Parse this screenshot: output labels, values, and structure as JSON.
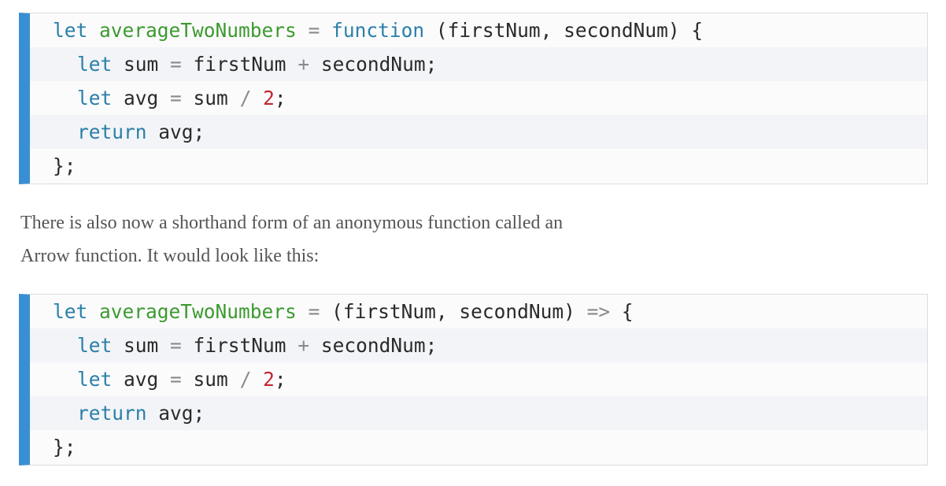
{
  "code_block_1": {
    "lines": [
      {
        "indent": 0,
        "tokens": [
          {
            "t": "let",
            "c": "kw"
          },
          {
            "t": " ",
            "c": "id"
          },
          {
            "t": "averageTwoNumbers",
            "c": "fn"
          },
          {
            "t": " ",
            "c": "id"
          },
          {
            "t": "=",
            "c": "op"
          },
          {
            "t": " ",
            "c": "id"
          },
          {
            "t": "function",
            "c": "kw"
          },
          {
            "t": " (firstNum, secondNum) {",
            "c": "id"
          }
        ]
      },
      {
        "indent": 1,
        "tokens": [
          {
            "t": "let",
            "c": "kw"
          },
          {
            "t": " sum ",
            "c": "id"
          },
          {
            "t": "=",
            "c": "op"
          },
          {
            "t": " firstNum ",
            "c": "id"
          },
          {
            "t": "+",
            "c": "op"
          },
          {
            "t": " secondNum;",
            "c": "id"
          }
        ]
      },
      {
        "indent": 1,
        "tokens": [
          {
            "t": "let",
            "c": "kw"
          },
          {
            "t": " avg ",
            "c": "id"
          },
          {
            "t": "=",
            "c": "op"
          },
          {
            "t": " sum ",
            "c": "id"
          },
          {
            "t": "/",
            "c": "op"
          },
          {
            "t": " ",
            "c": "id"
          },
          {
            "t": "2",
            "c": "num"
          },
          {
            "t": ";",
            "c": "id"
          }
        ]
      },
      {
        "indent": 1,
        "tokens": [
          {
            "t": "return",
            "c": "kw"
          },
          {
            "t": " avg;",
            "c": "id"
          }
        ]
      },
      {
        "indent": 0,
        "tokens": [
          {
            "t": "};",
            "c": "id"
          }
        ]
      }
    ]
  },
  "prose": {
    "line_1": "There is also now a shorthand form of an anonymous function called an",
    "line_2": "Arrow function. It would look like this:"
  },
  "code_block_2": {
    "lines": [
      {
        "indent": 0,
        "tokens": [
          {
            "t": "let",
            "c": "kw"
          },
          {
            "t": " ",
            "c": "id"
          },
          {
            "t": "averageTwoNumbers",
            "c": "fn"
          },
          {
            "t": " ",
            "c": "id"
          },
          {
            "t": "=",
            "c": "op"
          },
          {
            "t": " (firstNum, secondNum) ",
            "c": "id"
          },
          {
            "t": "=>",
            "c": "op"
          },
          {
            "t": " {",
            "c": "id"
          }
        ]
      },
      {
        "indent": 1,
        "tokens": [
          {
            "t": "let",
            "c": "kw"
          },
          {
            "t": " sum ",
            "c": "id"
          },
          {
            "t": "=",
            "c": "op"
          },
          {
            "t": " firstNum ",
            "c": "id"
          },
          {
            "t": "+",
            "c": "op"
          },
          {
            "t": " secondNum;",
            "c": "id"
          }
        ]
      },
      {
        "indent": 1,
        "tokens": [
          {
            "t": "let",
            "c": "kw"
          },
          {
            "t": " avg ",
            "c": "id"
          },
          {
            "t": "=",
            "c": "op"
          },
          {
            "t": " sum ",
            "c": "id"
          },
          {
            "t": "/",
            "c": "op"
          },
          {
            "t": " ",
            "c": "id"
          },
          {
            "t": "2",
            "c": "num"
          },
          {
            "t": ";",
            "c": "id"
          }
        ]
      },
      {
        "indent": 1,
        "tokens": [
          {
            "t": "return",
            "c": "kw"
          },
          {
            "t": " avg;",
            "c": "id"
          }
        ]
      },
      {
        "indent": 0,
        "tokens": [
          {
            "t": "};",
            "c": "id"
          }
        ]
      }
    ]
  },
  "colors": {
    "accent_bar": "#3a8fd4",
    "keyword": "#2a7fa8",
    "function_name": "#3c9a2f",
    "operator": "#8a8a8a",
    "number": "#c0262d",
    "text": "#2a2a2a",
    "prose": "#555555"
  }
}
